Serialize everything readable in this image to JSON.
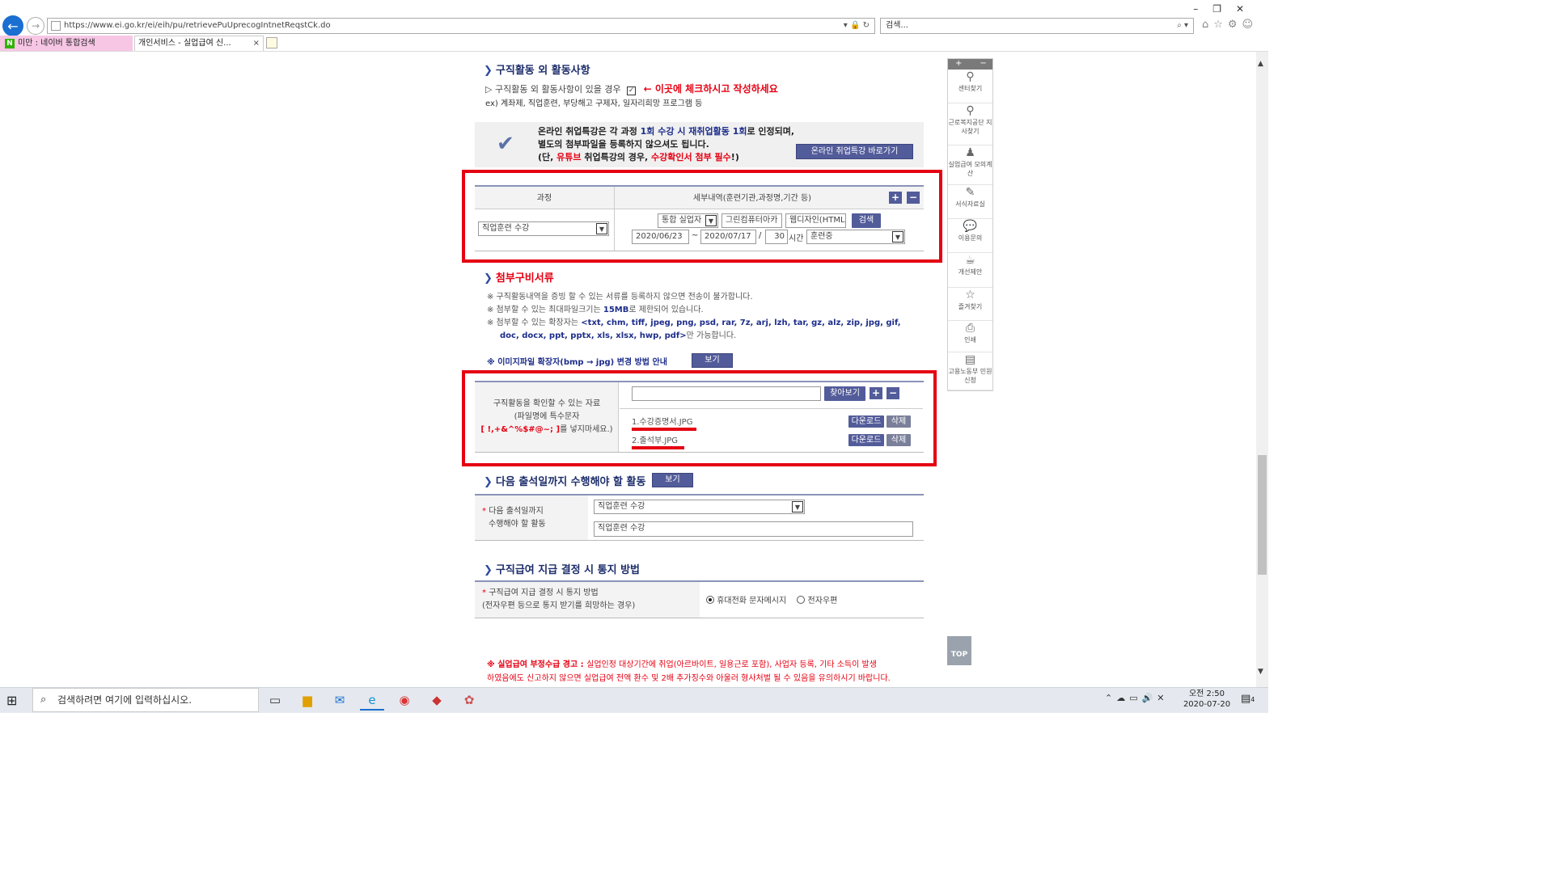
{
  "browser": {
    "url": "https://www.ei.go.kr/ei/eih/pu/retrievePuUprecogIntnetReqstCk.do",
    "search_placeholder": "검색...",
    "tabs": [
      {
        "label": "미만 : 네이버 통합검색"
      },
      {
        "label": "개인서비스 - 실업급여 신..."
      }
    ]
  },
  "section_activity": {
    "title": "구직활동 외 활동사항",
    "check_label": "▷ 구직활동 외 활동사항이 있을 경우",
    "check_note": "← 이곳에 체크하시고 작성하세요",
    "example": "ex) 계좌제, 직업훈련, 부당해고 구제자, 일자리희망 프로그램 등"
  },
  "online_notice": {
    "line1_a": "온라인 취업특강은 각 과정 ",
    "line1_b": "1회 수강 시 재취업활동 1회",
    "line1_c": "로 인정되며,",
    "line2": "별도의 첨부파일을 등록하지 않으셔도 됩니다.",
    "line3_a": "(단, ",
    "line3_b": "유튜브",
    "line3_c": " 취업특강의 경우, ",
    "line3_d": "수강확인서 첨부 필수",
    "line3_e": "!)",
    "button": "온라인 취업특강 바로가기"
  },
  "course_table": {
    "col1": "과정",
    "col2": "세부내역(훈련기관,과정명,기간 등)",
    "course_select": "직업훈련 수강",
    "type_select": "통합 실업자",
    "institution": "그린컴퓨터아카",
    "course_name": "웹디자인(HTML",
    "search_button": "검색",
    "date_from": "2020/06/23",
    "tilde": "~",
    "date_to": "2020/07/17",
    "slash": "/",
    "hours": "30",
    "hours_label": "시간",
    "status_select": "훈련중"
  },
  "attachments": {
    "title": "첨부구비서류",
    "note1": "※ 구직활동내역을 증빙 할 수 있는 서류를 등록하지 않으면 전송이 불가합니다.",
    "note2_a": "※ 첨부할 수 있는 최대파일크기는 ",
    "note2_b": "15MB",
    "note2_c": "로 제한되어 있습니다.",
    "note3_a": "※ 첨부할 수 있는 확장자는 ",
    "note3_b": "<txt, chm, tiff, jpeg, png, psd, rar, 7z, arj, lzh, tar, gz, alz, zip, jpg, gif,",
    "note3_c": "doc, docx, ppt, pptx, xls, xlsx, hwp, pdf>",
    "note3_d": "만 가능합니다.",
    "image_note": "※ 이미지파일 확장자(bmp → jpg) 변경 방법 안내",
    "view_button": "보기",
    "label1": "구직활동을 확인할 수 있는 자료",
    "label2": "(파일명에 특수문자",
    "label3_a": "[ !,+&^%$#@~; ]",
    "label3_b": "를 넣지마세요.)",
    "browse_button": "찾아보기",
    "files": [
      {
        "name": "1.수강증명서.JPG",
        "download": "다운로드",
        "delete": "삭제"
      },
      {
        "name": "2.출석부.JPG",
        "download": "다운로드",
        "delete": "삭제"
      }
    ]
  },
  "next_activity": {
    "title": "다음 출석일까지 수행해야 할 활동",
    "view_button": "보기",
    "label1": "다음 출석일까지",
    "label2": "수행해야 할 활동",
    "select": "직업훈련 수강",
    "input": "직업훈련 수강"
  },
  "notify": {
    "title": "구직급여 지급 결정 시 통지 방법",
    "label1": "구직급여 지급 결정 시 통지 방법",
    "label2": "(전자우편 등으로 통지 받기를 희망하는 경우)",
    "opt1": "휴대전화 문자메시지",
    "opt2": "전자우편"
  },
  "warning": {
    "bold": "※ 실업급여 부정수급 경고 : ",
    "line1": "실업인정 대상기간에 취업(아르바이트, 일용근로 포함), 사업자 등록, 기타 소득이 발생",
    "line2": "하였음에도 신고하지 않으면 실업급여 전액 환수 및 2배 추가징수와 아울러 형사처벌 될 수 있음을 유의하시기 바랍니다."
  },
  "sidebar": {
    "items": [
      {
        "label": "센터찾기",
        "icon": "location-pin-icon"
      },
      {
        "label": "근로복지공단 지사찾기",
        "icon": "location-pin-icon"
      },
      {
        "label": "실업급여 모의계산",
        "icon": "person-icon"
      },
      {
        "label": "서식자료실",
        "icon": "edit-icon"
      },
      {
        "label": "이용문의",
        "icon": "speech-bubble-icon"
      },
      {
        "label": "개선제안",
        "icon": "cup-icon"
      },
      {
        "label": "즐겨찾기",
        "icon": "star-icon"
      },
      {
        "label": "인쇄",
        "icon": "printer-icon"
      },
      {
        "label": "고용노동부 민원신청",
        "icon": "document-icon"
      }
    ],
    "top": "TOP"
  },
  "taskbar": {
    "search_placeholder": "검색하려면 여기에 입력하십시오.",
    "time": "오전 2:50",
    "date": "2020-07-20",
    "notif_count": "4"
  },
  "colors": {
    "accent": "#535c9a",
    "highlight": "#e50012",
    "heading": "#1d2d6b"
  }
}
